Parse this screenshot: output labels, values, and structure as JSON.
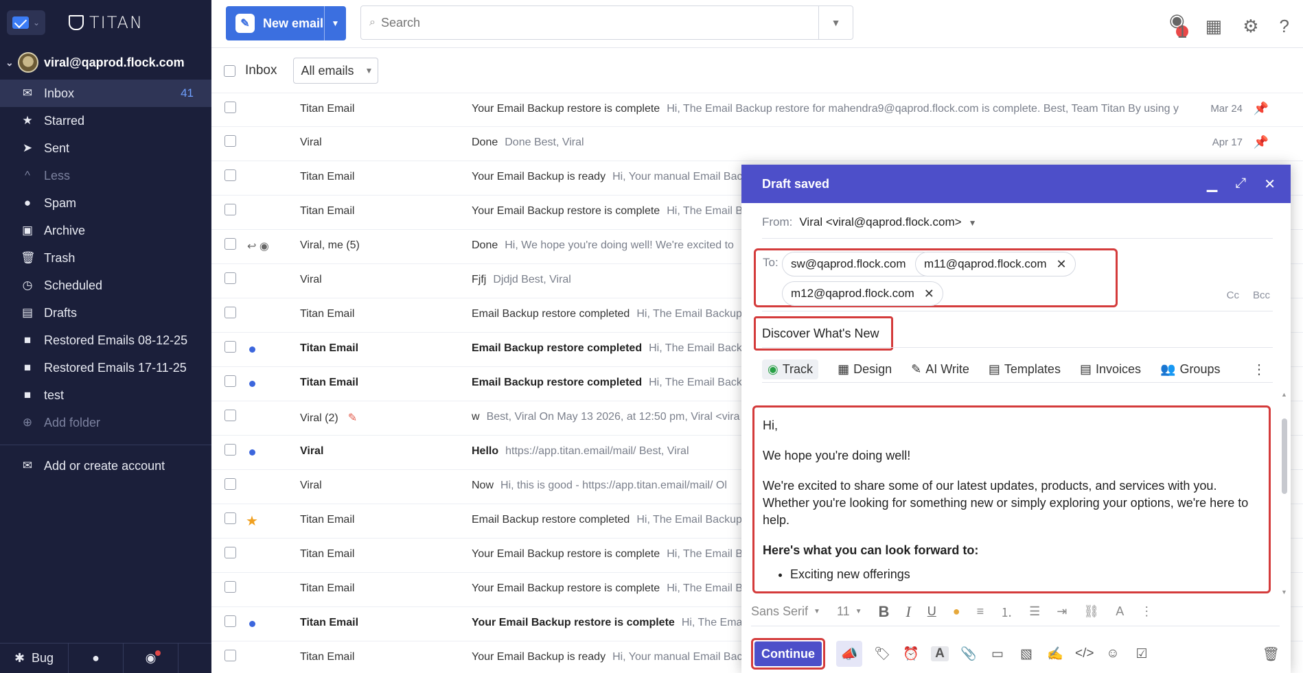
{
  "app": {
    "brand": "TITAN"
  },
  "account": {
    "email": "viral@qaprod.flock.com"
  },
  "sidebar": {
    "items": [
      {
        "label": "Inbox",
        "icon": "inbox-icon",
        "count": "41"
      },
      {
        "label": "Starred",
        "icon": "star-icon"
      },
      {
        "label": "Sent",
        "icon": "send-icon"
      },
      {
        "label": "Less",
        "icon": "chevron-up-icon"
      },
      {
        "label": "Spam",
        "icon": "spam-icon"
      },
      {
        "label": "Archive",
        "icon": "archive-icon"
      },
      {
        "label": "Trash",
        "icon": "trash-icon"
      },
      {
        "label": "Scheduled",
        "icon": "clock-icon"
      },
      {
        "label": "Drafts",
        "icon": "drafts-icon"
      },
      {
        "label": "Restored Emails 08-12-25",
        "icon": "folder-icon"
      },
      {
        "label": "Restored Emails 17-11-25",
        "icon": "folder-icon"
      },
      {
        "label": "test",
        "icon": "folder-icon"
      },
      {
        "label": "Add folder",
        "icon": "plus-circle-icon"
      }
    ],
    "add_account": "Add or create account",
    "footer": {
      "bug": "Bug"
    }
  },
  "toolbar": {
    "new_email": "New email",
    "search_placeholder": "Search",
    "notification_count": "1"
  },
  "list": {
    "title": "Inbox",
    "filter": "All emails",
    "rows": [
      {
        "sender": "Titan Email",
        "subject": "Your Email Backup restore is complete",
        "preview": "Hi, The Email Backup restore for mahendra9@qaprod.flock.com is complete. Best, Team Titan By using y",
        "date": "Mar 24",
        "pinned": true
      },
      {
        "sender": "Viral",
        "subject": "Done",
        "preview": "Done Best, Viral",
        "date": "Apr 17",
        "pinned": true
      },
      {
        "sender": "Titan Email",
        "subject": "Your Email Backup is ready",
        "preview": "Hi, Your manual Email Bac"
      },
      {
        "sender": "Titan Email",
        "subject": "Your Email Backup restore is complete",
        "preview": "Hi, The Email B"
      },
      {
        "sender": "Viral, me (5)",
        "subject": "Done",
        "preview": "Hi, We hope you're doing well! We're excited to"
      },
      {
        "sender": "Viral",
        "subject": "Fjfj",
        "preview": "Djdjd Best, Viral"
      },
      {
        "sender": "Titan Email",
        "subject": "Email Backup restore completed",
        "preview": "Hi, The Email Backup"
      },
      {
        "sender": "Titan Email",
        "subject": "Email Backup restore completed",
        "preview": "Hi, The Email Backu",
        "unread": true
      },
      {
        "sender": "Titan Email",
        "subject": "Email Backup restore completed",
        "preview": "Hi, The Email Backu",
        "unread": true
      },
      {
        "sender": "Viral (2)",
        "subject": "w",
        "preview": "Best, Viral On May 13 2026, at 12:50 pm, Viral <vira",
        "draft": true
      },
      {
        "sender": "Viral",
        "subject": "Hello",
        "preview": "https://app.titan.email/mail/ Best, Viral",
        "unread": true
      },
      {
        "sender": "Viral",
        "subject": "Now",
        "preview": "Hi, this is good - https://app.titan.email/mail/ Ol"
      },
      {
        "sender": "Titan Email",
        "subject": "Email Backup restore completed",
        "preview": "Hi, The Email Backup",
        "starred": true
      },
      {
        "sender": "Titan Email",
        "subject": "Your Email Backup restore is complete",
        "preview": "Hi, The Email B"
      },
      {
        "sender": "Titan Email",
        "subject": "Your Email Backup restore is complete",
        "preview": "Hi, The Email B"
      },
      {
        "sender": "Titan Email",
        "subject": "Your Email Backup restore is complete",
        "preview": "Hi, The Email",
        "unread": true
      },
      {
        "sender": "Titan Email",
        "subject": "Your Email Backup is ready",
        "preview": "Hi, Your manual Email Bac"
      }
    ]
  },
  "compose": {
    "title": "Draft saved",
    "from_label": "From:",
    "from_value": "Viral <viral@qaprod.flock.com>",
    "to_label": "To:",
    "recipients": [
      "sw@qaprod.flock.com",
      "m11@qaprod.flock.com",
      "m12@qaprod.flock.com"
    ],
    "cc": "Cc",
    "bcc": "Bcc",
    "subject": "Discover What's New",
    "tools": [
      "Track",
      "Design",
      "AI Write",
      "Templates",
      "Invoices",
      "Groups"
    ],
    "body": {
      "greeting": "Hi,",
      "line1": "We hope you're doing well!",
      "line2": "We're excited to share some of our latest updates, products, and services with you. Whether you're looking for something new or simply exploring your options, we're here to help.",
      "heading": "Here's what you can look forward to:",
      "bullet1": "Exciting new offerings"
    },
    "format": {
      "font": "Sans Serif",
      "size": "11"
    },
    "continue": "Continue"
  }
}
